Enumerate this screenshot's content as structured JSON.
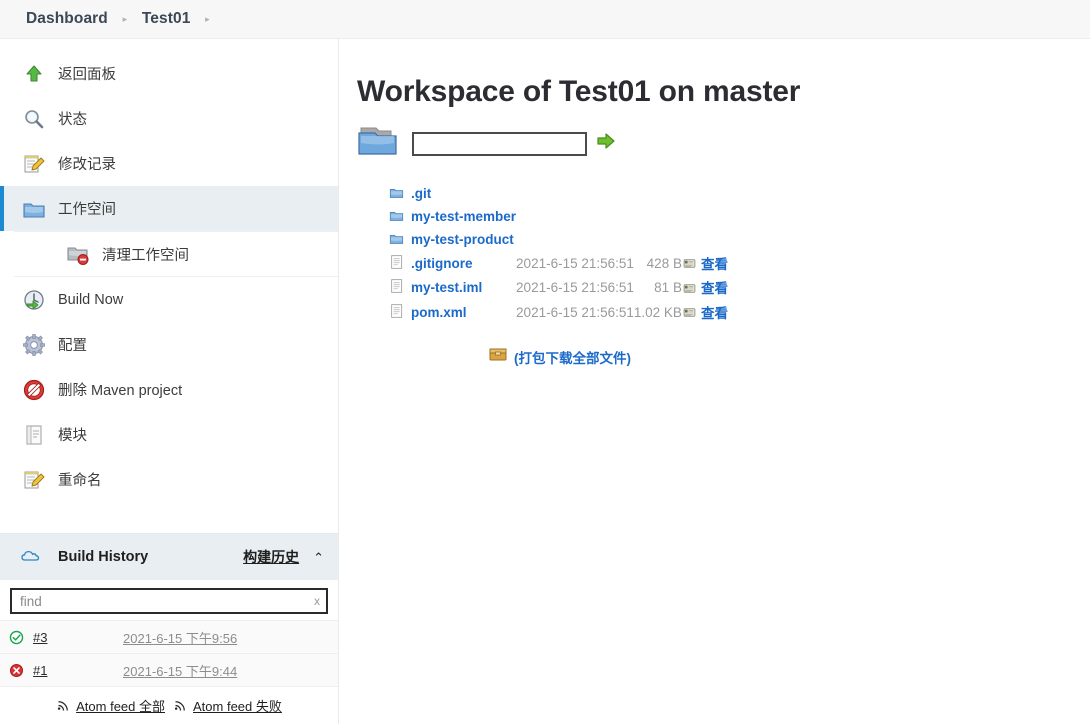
{
  "breadcrumb": {
    "items": [
      {
        "label": "Dashboard"
      },
      {
        "label": "Test01"
      }
    ],
    "separator": "▸"
  },
  "sidebar": {
    "tasks": [
      {
        "label": "返回面板",
        "icon": "up-arrow-green-icon",
        "selected": false,
        "sub": false
      },
      {
        "label": "状态",
        "icon": "magnifier-icon",
        "selected": false,
        "sub": false
      },
      {
        "label": "修改记录",
        "icon": "notepad-pencil-icon",
        "selected": false,
        "sub": false
      },
      {
        "label": "工作空间",
        "icon": "folder-icon",
        "selected": true,
        "sub": false
      },
      {
        "label": "清理工作空间",
        "icon": "folder-delete-icon",
        "selected": false,
        "sub": true
      },
      {
        "label": "Build Now",
        "icon": "build-clock-icon",
        "selected": false,
        "sub": false
      },
      {
        "label": "配置",
        "icon": "gear-icon",
        "selected": false,
        "sub": false
      },
      {
        "label": "删除 Maven project",
        "icon": "no-entry-icon",
        "selected": false,
        "sub": false
      },
      {
        "label": "模块",
        "icon": "module-icon",
        "selected": false,
        "sub": false
      },
      {
        "label": "重命名",
        "icon": "notepad-pencil-icon",
        "selected": false,
        "sub": false
      }
    ],
    "build_history": {
      "title": "Build History",
      "title_cn": "构建历史",
      "collapse_glyph": "⌃",
      "cloud_icon": "cloud-icon",
      "search_placeholder": "find",
      "search_value": "",
      "search_clear": "x",
      "builds": [
        {
          "number": "#3",
          "date": "2021-6-15 下午9:56",
          "status": "success"
        },
        {
          "number": "#1",
          "date": "2021-6-15 下午9:44",
          "status": "failed"
        }
      ],
      "atom_feeds": [
        {
          "label": "Atom feed 全部"
        },
        {
          "label": "Atom feed 失败"
        }
      ]
    }
  },
  "main": {
    "title": "Workspace of Test01 on master",
    "path_form": {
      "folder_icon": "folder-open-icon",
      "input_value": "",
      "input_placeholder": "",
      "submit_icon": "green-arrow-icon"
    },
    "file_table": {
      "rows": [
        {
          "type": "dir",
          "icon": "folder-icon",
          "name": ".git",
          "date": "",
          "size": "",
          "view": ""
        },
        {
          "type": "dir",
          "icon": "folder-icon",
          "name": "my-test-member",
          "date": "",
          "size": "",
          "view": ""
        },
        {
          "type": "dir",
          "icon": "folder-icon",
          "name": "my-test-product",
          "date": "",
          "size": "",
          "view": ""
        },
        {
          "type": "file",
          "icon": "file-icon",
          "name": ".gitignore",
          "date": "2021-6-15 21:56:51",
          "size": "428 B",
          "view": "查看"
        },
        {
          "type": "file",
          "icon": "file-icon",
          "name": "my-test.iml",
          "date": "2021-6-15 21:56:51",
          "size": "81 B",
          "view": "查看"
        },
        {
          "type": "file",
          "icon": "file-icon",
          "name": "pom.xml",
          "date": "2021-6-15 21:56:51",
          "size": "1.02 KB",
          "view": "查看"
        }
      ]
    },
    "download_all": {
      "icon": "archive-box-icon",
      "label": "(打包下载全部文件)"
    }
  },
  "colors": {
    "header_bg": "#f7f7f7",
    "accent_blue": "#1b8ad0",
    "link_blue": "#1b6ac9",
    "selected_bg": "#e8eef1",
    "success_green": "#17a74a",
    "failure_red": "#d63434",
    "muted_text": "#9a9a9a"
  }
}
